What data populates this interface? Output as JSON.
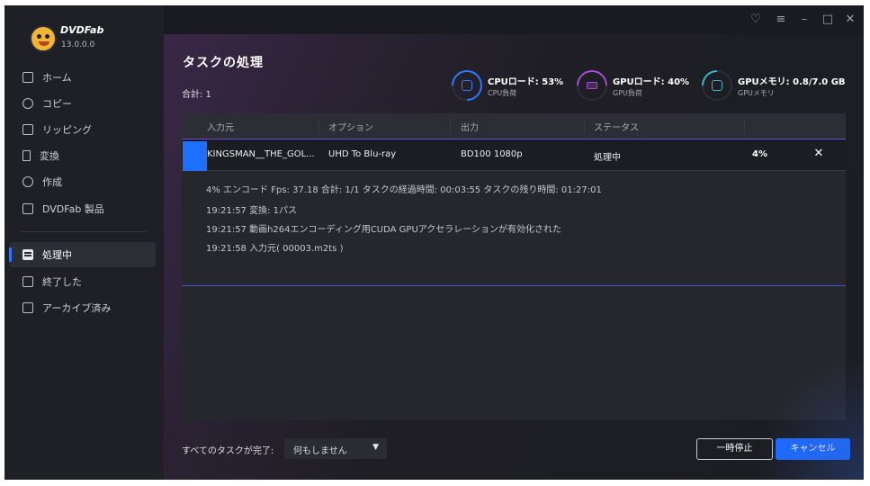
{
  "app": {
    "brand": "DVDFab",
    "version": "13.0.0.0"
  },
  "sidebar": {
    "items": [
      {
        "label": "ホーム",
        "icon": "home-icon"
      },
      {
        "label": "コピー",
        "icon": "copy-icon"
      },
      {
        "label": "リッピング",
        "icon": "ripper-icon"
      },
      {
        "label": "変換",
        "icon": "converter-icon"
      },
      {
        "label": "作成",
        "icon": "creator-icon"
      },
      {
        "label": "DVDFab 製品",
        "icon": "product-icon"
      },
      {
        "label": "処理中",
        "icon": "processing-icon",
        "active": true
      },
      {
        "label": "終了した",
        "icon": "finished-icon"
      },
      {
        "label": "アーカイブ済み",
        "icon": "archive-icon"
      }
    ]
  },
  "window": {
    "icons": [
      "theme-icon",
      "menu-icon",
      "minimize-icon",
      "maximize-icon",
      "close-icon"
    ]
  },
  "main": {
    "title": "タスクの処理",
    "total": "合計: 1",
    "stats": {
      "cpu": {
        "label": "CPUロード: 53%",
        "sub": "CPU負荷",
        "value": 53,
        "color": "#2f78ff"
      },
      "gpu": {
        "label": "GPUロード: 40%",
        "sub": "GPU負荷",
        "value": 40,
        "color": "#a64bd6"
      },
      "gpumem": {
        "label": "GPUメモリ: 0.8/7.0 GB",
        "sub": "GPUメモリ",
        "value": 11,
        "color": "#3ab6c8"
      }
    },
    "table": {
      "headers": [
        "入力元",
        "オプション",
        "出力",
        "ステータス"
      ],
      "row": {
        "source": "KINGSMAN__THE_GOL...",
        "option": "UHD To Blu-ray",
        "output": "BD100 1080p",
        "status": "処理中",
        "progress": "4%"
      },
      "log": [
        "4% エンコード Fps: 37.18  合計: 1/1  タスクの経過時間: 00:03:55  タスクの残り時間: 01:27:01",
        "19:21:57  変換: 1パス",
        "19:21:57  動画h264エンコーディング用CUDA GPUアクセラレーションが有効化された",
        "19:21:58  入力元( 00003.m2ts )"
      ]
    },
    "footer": {
      "label": "すべてのタスクが完了:",
      "after_action": "何もしません",
      "pause": "一時停止",
      "cancel": "キャンセル"
    }
  }
}
